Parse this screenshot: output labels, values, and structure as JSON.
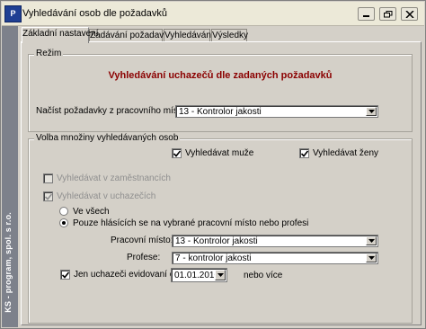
{
  "window": {
    "title": "Vyhledávání osob dle požadavků",
    "icon_text": "P",
    "sidebar_text": "KS - program, spol. s r.o."
  },
  "tabs": [
    {
      "label": "Základní nastavení",
      "active": true
    },
    {
      "label": "Zadávání požadavků",
      "active": false
    },
    {
      "label": "Vyhledávání",
      "active": false
    },
    {
      "label": "Výsledky",
      "active": false
    }
  ],
  "rezim": {
    "legend": "Režim",
    "heading": "Vyhledávání uchazečů dle zadaných požadavků",
    "accent_color": "#8b0000"
  },
  "load_req": {
    "label": "Načíst požadavky z pracovního místa:",
    "value": "13 - Kontrolor jakosti"
  },
  "volba": {
    "legend": "Volba množiny vyhledávaných osob",
    "search_men": {
      "label": "Vyhledávat muže",
      "checked": true
    },
    "search_women": {
      "label": "Vyhledávat ženy",
      "checked": true
    },
    "search_employees": {
      "label": "Vyhledávat v zaměstnancích",
      "checked": false,
      "disabled": true
    },
    "search_applicants": {
      "label": "Vyhledávat v uchazečích",
      "checked": true,
      "disabled": true
    },
    "radio_all": {
      "label": "Ve všech",
      "selected": false
    },
    "radio_only": {
      "label": "Pouze hlásících se na vybrané pracovní místo nebo profesi",
      "selected": true
    },
    "position": {
      "label": "Pracovní místo:",
      "value": "13 - Kontrolor jakosti"
    },
    "profession": {
      "label": "Profese:",
      "value": "7 - kontrolor jakosti"
    },
    "registered_from": {
      "label": "Jen uchazeči evidovaní od:",
      "checked": true,
      "date": "01.01.2010",
      "suffix": "nebo více"
    }
  }
}
